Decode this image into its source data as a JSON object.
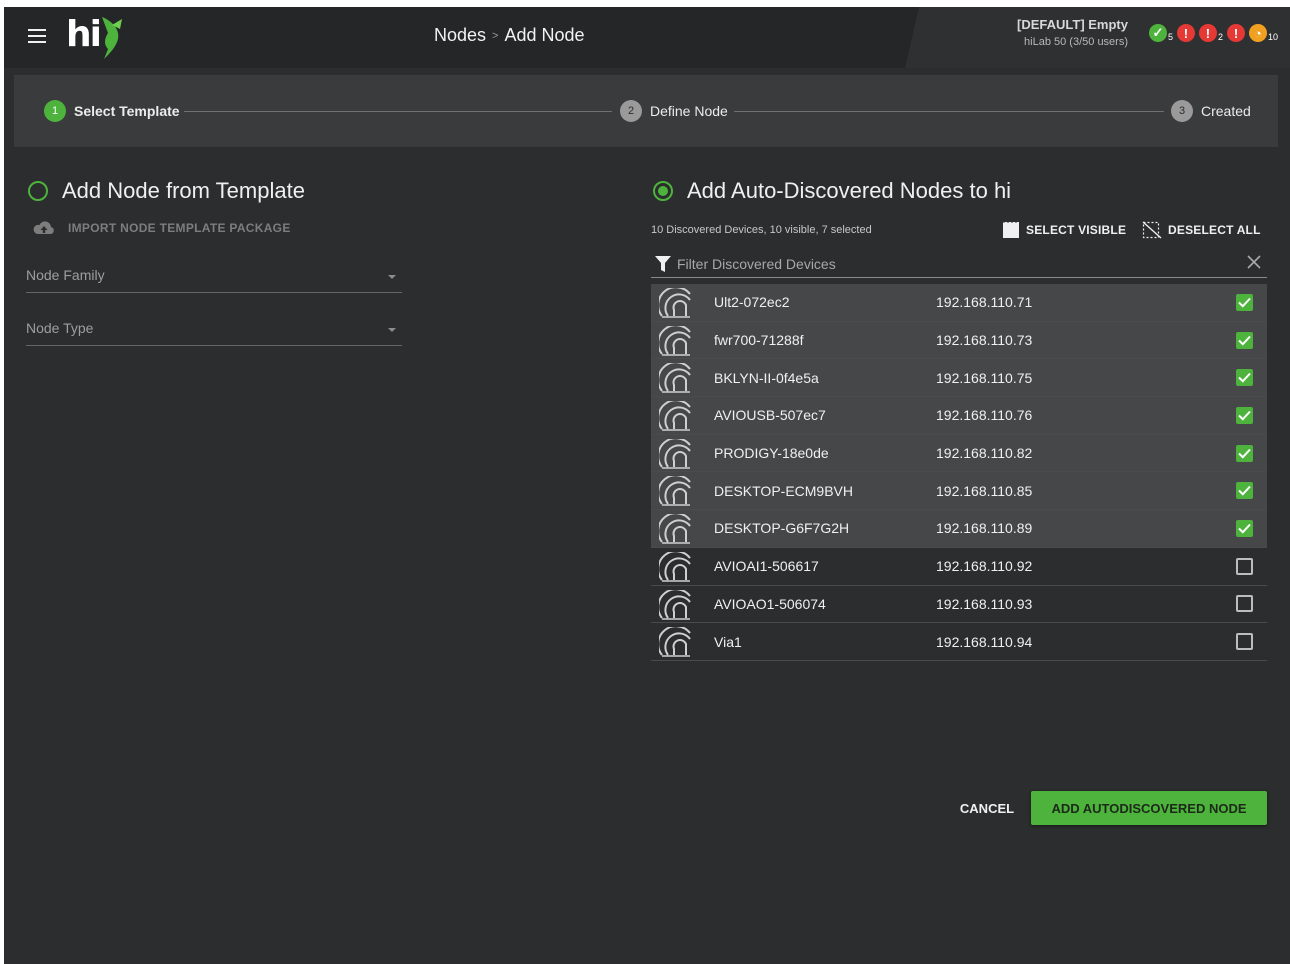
{
  "header": {
    "breadcrumbs": [
      "Nodes",
      "Add Node"
    ],
    "breadcrumb_separator": ">",
    "system_title": "[DEFAULT] Empty",
    "system_subtitle": "hiLab 50 (3/50 users)",
    "status": [
      {
        "icon": "ok-check-icon",
        "color": "#4db33d",
        "count": "5"
      },
      {
        "icon": "error-icon",
        "color": "#e53935",
        "count": ""
      },
      {
        "icon": "error-icon",
        "color": "#e53935",
        "count": "2"
      },
      {
        "icon": "error-icon",
        "color": "#e53935",
        "count": ""
      },
      {
        "icon": "warning-icon",
        "color": "#f0a020",
        "count": "10"
      }
    ]
  },
  "stepper": {
    "steps": [
      {
        "num": "1",
        "label": "Select Template",
        "active": true
      },
      {
        "num": "2",
        "label": "Define Node",
        "active": false
      },
      {
        "num": "3",
        "label": "Created",
        "active": false
      }
    ]
  },
  "left": {
    "title": "Add Node from Template",
    "selected": false,
    "import_label": "IMPORT NODE TEMPLATE PACKAGE",
    "node_family_label": "Node Family",
    "node_type_label": "Node Type"
  },
  "right": {
    "title": "Add Auto-Discovered Nodes to hi",
    "selected": true,
    "summary": "10 Discovered Devices, 10 visible, 7 selected",
    "select_visible_label": "SELECT VISIBLE",
    "deselect_all_label": "DESELECT ALL",
    "filter_placeholder": "Filter Discovered Devices",
    "filter_value": "",
    "devices": [
      {
        "name": "Ult2-072ec2",
        "ip": "192.168.110.71",
        "checked": true
      },
      {
        "name": "fwr700-71288f",
        "ip": "192.168.110.73",
        "checked": true
      },
      {
        "name": "BKLYN-II-0f4e5a",
        "ip": "192.168.110.75",
        "checked": true
      },
      {
        "name": "AVIOUSB-507ec7",
        "ip": "192.168.110.76",
        "checked": true
      },
      {
        "name": "PRODIGY-18e0de",
        "ip": "192.168.110.82",
        "checked": true
      },
      {
        "name": "DESKTOP-ECM9BVH",
        "ip": "192.168.110.85",
        "checked": true
      },
      {
        "name": "DESKTOP-G6F7G2H",
        "ip": "192.168.110.89",
        "checked": true
      },
      {
        "name": "AVIOAI1-506617",
        "ip": "192.168.110.92",
        "checked": false
      },
      {
        "name": "AVIOAO1-506074",
        "ip": "192.168.110.93",
        "checked": false
      },
      {
        "name": "Via1",
        "ip": "192.168.110.94",
        "checked": false
      }
    ]
  },
  "actions": {
    "cancel_label": "CANCEL",
    "add_label": "ADD AUTODISCOVERED NODE"
  },
  "colors": {
    "accent": "#4db33d",
    "background": "#2c2d2e",
    "header": "#252627",
    "stepper": "#3a3b3c"
  }
}
